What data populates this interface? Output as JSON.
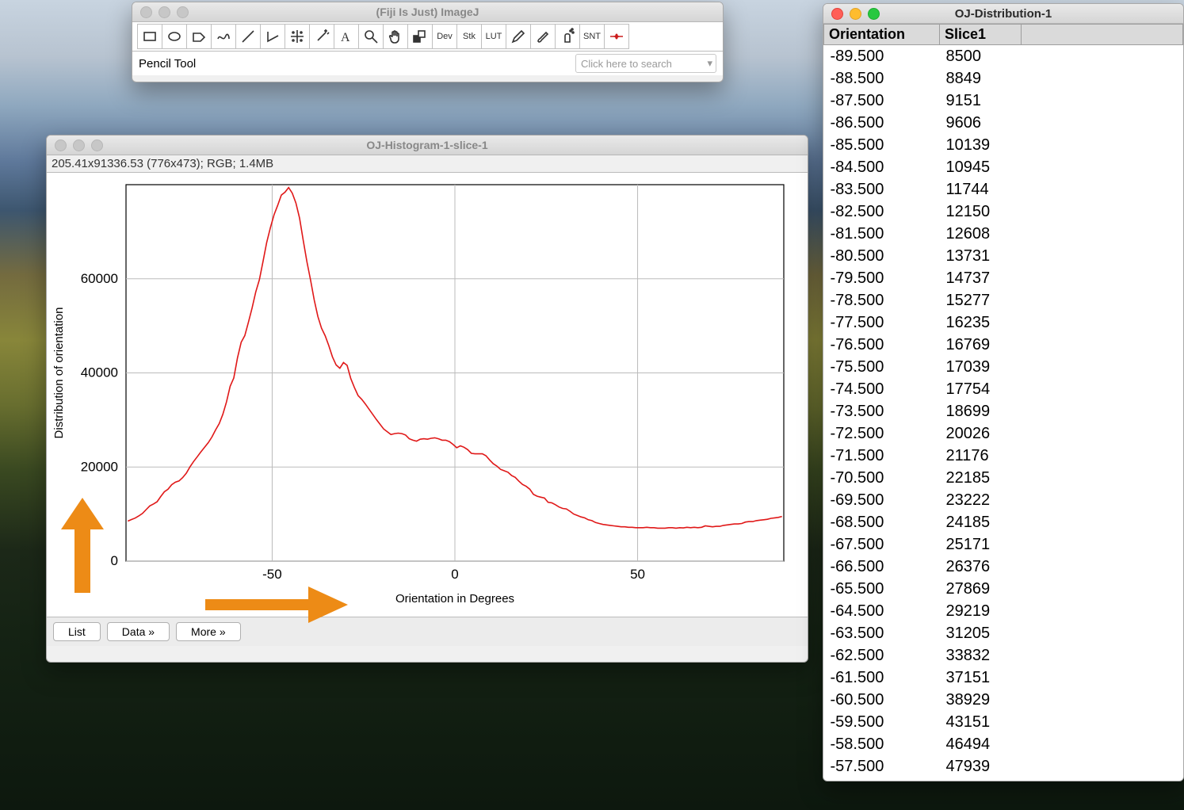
{
  "imagej": {
    "title": "(Fiji Is Just) ImageJ",
    "status": "Pencil Tool",
    "search_placeholder": "Click here to search",
    "tools": [
      "rectangle",
      "oval",
      "polygon",
      "freehand",
      "line",
      "angle",
      "point",
      "wand",
      "text",
      "magnify",
      "hand",
      "color-picker",
      "dev",
      "stk",
      "lut",
      "pencil",
      "brush",
      "spray",
      "snt",
      "arrows"
    ],
    "tool_text": {
      "dev": "Dev",
      "stk": "Stk",
      "lut": "LUT",
      "snt": "SNT"
    }
  },
  "histogram": {
    "window_title": "OJ-Histogram-1-slice-1",
    "info": "205.41x91336.53   (776x473); RGB; 1.4MB",
    "xlabel": "Orientation in Degrees",
    "ylabel": "Distribution of orientation",
    "buttons": {
      "list": "List",
      "data": "Data »",
      "more": "More »"
    }
  },
  "distribution": {
    "window_title": "OJ-Distribution-1",
    "headers": {
      "c0": "Orientation",
      "c1": "Slice1"
    },
    "rows": [
      {
        "o": "-89.500",
        "v": "8500"
      },
      {
        "o": "-88.500",
        "v": "8849"
      },
      {
        "o": "-87.500",
        "v": "9151"
      },
      {
        "o": "-86.500",
        "v": "9606"
      },
      {
        "o": "-85.500",
        "v": "10139"
      },
      {
        "o": "-84.500",
        "v": "10945"
      },
      {
        "o": "-83.500",
        "v": "11744"
      },
      {
        "o": "-82.500",
        "v": "12150"
      },
      {
        "o": "-81.500",
        "v": "12608"
      },
      {
        "o": "-80.500",
        "v": "13731"
      },
      {
        "o": "-79.500",
        "v": "14737"
      },
      {
        "o": "-78.500",
        "v": "15277"
      },
      {
        "o": "-77.500",
        "v": "16235"
      },
      {
        "o": "-76.500",
        "v": "16769"
      },
      {
        "o": "-75.500",
        "v": "17039"
      },
      {
        "o": "-74.500",
        "v": "17754"
      },
      {
        "o": "-73.500",
        "v": "18699"
      },
      {
        "o": "-72.500",
        "v": "20026"
      },
      {
        "o": "-71.500",
        "v": "21176"
      },
      {
        "o": "-70.500",
        "v": "22185"
      },
      {
        "o": "-69.500",
        "v": "23222"
      },
      {
        "o": "-68.500",
        "v": "24185"
      },
      {
        "o": "-67.500",
        "v": "25171"
      },
      {
        "o": "-66.500",
        "v": "26376"
      },
      {
        "o": "-65.500",
        "v": "27869"
      },
      {
        "o": "-64.500",
        "v": "29219"
      },
      {
        "o": "-63.500",
        "v": "31205"
      },
      {
        "o": "-62.500",
        "v": "33832"
      },
      {
        "o": "-61.500",
        "v": "37151"
      },
      {
        "o": "-60.500",
        "v": "38929"
      },
      {
        "o": "-59.500",
        "v": "43151"
      },
      {
        "o": "-58.500",
        "v": "46494"
      },
      {
        "o": "-57.500",
        "v": "47939"
      }
    ]
  },
  "chart_data": {
    "type": "line",
    "title": "",
    "xlabel": "Orientation in Degrees",
    "ylabel": "Distribution of orientation",
    "xlim": [
      -90,
      90
    ],
    "ylim": [
      0,
      80000
    ],
    "x_ticks": [
      -50,
      0,
      50
    ],
    "y_ticks": [
      0,
      20000,
      40000,
      60000
    ],
    "x": [
      -89.5,
      -88.5,
      -87.5,
      -86.5,
      -85.5,
      -84.5,
      -83.5,
      -82.5,
      -81.5,
      -80.5,
      -79.5,
      -78.5,
      -77.5,
      -76.5,
      -75.5,
      -74.5,
      -73.5,
      -72.5,
      -71.5,
      -70.5,
      -69.5,
      -68.5,
      -67.5,
      -66.5,
      -65.5,
      -64.5,
      -63.5,
      -62.5,
      -61.5,
      -60.5,
      -59.5,
      -58.5,
      -57.5,
      -56.5,
      -55.5,
      -54.5,
      -53.5,
      -52.5,
      -51.5,
      -50.5,
      -49.5,
      -48.5,
      -47.5,
      -46.5,
      -45.5,
      -44.5,
      -43.5,
      -42.5,
      -41.5,
      -40.5,
      -39.5,
      -38.5,
      -37.5,
      -36.5,
      -35.5,
      -34.5,
      -33.5,
      -32.5,
      -31.5,
      -30.5,
      -29.5,
      -28.5,
      -27.5,
      -26.5,
      -25.5,
      -24.5,
      -23.5,
      -22.5,
      -21.5,
      -20.5,
      -19.5,
      -18.5,
      -17.5,
      -16.5,
      -15.5,
      -14.5,
      -13.5,
      -12.5,
      -11.5,
      -10.5,
      -9.5,
      -8.5,
      -7.5,
      -6.5,
      -5.5,
      -4.5,
      -3.5,
      -2.5,
      -1.5,
      -0.5,
      0.5,
      1.5,
      2.5,
      3.5,
      4.5,
      5.5,
      6.5,
      7.5,
      8.5,
      9.5,
      10.5,
      11.5,
      12.5,
      13.5,
      14.5,
      15.5,
      16.5,
      17.5,
      18.5,
      19.5,
      20.5,
      21.5,
      22.5,
      23.5,
      24.5,
      25.5,
      26.5,
      27.5,
      28.5,
      29.5,
      30.5,
      31.5,
      32.5,
      33.5,
      34.5,
      35.5,
      36.5,
      37.5,
      38.5,
      39.5,
      40.5,
      41.5,
      42.5,
      43.5,
      44.5,
      45.5,
      46.5,
      47.5,
      48.5,
      49.5,
      50.5,
      51.5,
      52.5,
      53.5,
      54.5,
      55.5,
      56.5,
      57.5,
      58.5,
      59.5,
      60.5,
      61.5,
      62.5,
      63.5,
      64.5,
      65.5,
      66.5,
      67.5,
      68.5,
      69.5,
      70.5,
      71.5,
      72.5,
      73.5,
      74.5,
      75.5,
      76.5,
      77.5,
      78.5,
      79.5,
      80.5,
      81.5,
      82.5,
      83.5,
      84.5,
      85.5,
      86.5,
      87.5,
      88.5,
      89.5
    ],
    "values": [
      8500,
      8849,
      9151,
      9606,
      10139,
      10945,
      11744,
      12150,
      12608,
      13731,
      14737,
      15277,
      16235,
      16769,
      17039,
      17754,
      18699,
      20026,
      21176,
      22185,
      23222,
      24185,
      25171,
      26376,
      27869,
      29219,
      31205,
      33832,
      37151,
      38929,
      43151,
      46494,
      47939,
      50800,
      53800,
      57200,
      59800,
      63700,
      67700,
      70800,
      73600,
      75600,
      77800,
      78400,
      79400,
      78200,
      76100,
      72900,
      68200,
      63600,
      59700,
      55500,
      52000,
      49500,
      47900,
      45800,
      43400,
      41700,
      41000,
      42200,
      41600,
      38800,
      36900,
      35200,
      34400,
      33400,
      32300,
      31200,
      30100,
      29100,
      28100,
      27500,
      26900,
      27100,
      27200,
      27100,
      26800,
      26000,
      25700,
      25500,
      25900,
      26000,
      25900,
      26100,
      26200,
      26000,
      25700,
      25700,
      25400,
      24800,
      24100,
      24500,
      24200,
      23700,
      22900,
      22800,
      22800,
      22800,
      22400,
      21500,
      20700,
      20200,
      19500,
      19200,
      18900,
      18200,
      17800,
      17000,
      16300,
      15900,
      15300,
      14200,
      13800,
      13600,
      13400,
      12500,
      12400,
      12000,
      11500,
      11200,
      11100,
      10600,
      10000,
      9700,
      9400,
      9200,
      8800,
      8600,
      8200,
      8000,
      7800,
      7700,
      7600,
      7500,
      7400,
      7300,
      7300,
      7200,
      7200,
      7100,
      7100,
      7100,
      7200,
      7100,
      7100,
      7000,
      7000,
      7000,
      7100,
      7100,
      7000,
      7100,
      7050,
      7200,
      7100,
      7200,
      7100,
      7200,
      7500,
      7400,
      7300,
      7400,
      7400,
      7600,
      7700,
      7800,
      7900,
      7900,
      8000,
      8300,
      8400,
      8400,
      8600,
      8700,
      8800,
      8900,
      9100,
      9200,
      9300,
      9500
    ]
  }
}
